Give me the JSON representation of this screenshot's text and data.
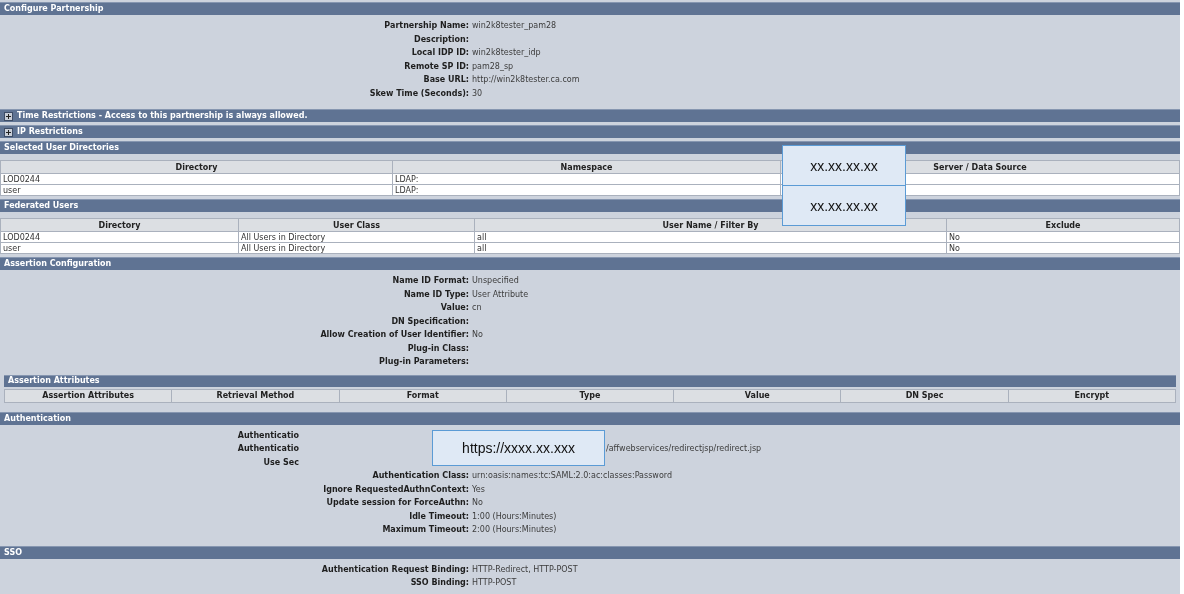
{
  "sections": [
    {
      "kind": "fields",
      "title": "Configure Partnership",
      "fields": [
        {
          "kind": "full",
          "label": "Partnership Name:",
          "value": "win2k8tester_pam28"
        },
        {
          "kind": "full",
          "label": "Description:"
        },
        {
          "kind": "full",
          "label": "Local IDP ID:",
          "value": "win2k8tester_idp"
        },
        {
          "kind": "full",
          "label": "Remote SP ID:",
          "value": "pam28_sp"
        },
        {
          "kind": "full",
          "label": "Base URL:",
          "value": "http://win2k8tester.ca.com"
        },
        {
          "kind": "full",
          "label": "Skew Time (Seconds):",
          "value": "30"
        }
      ]
    },
    {
      "kind": "collapsible",
      "title": "Time Restrictions - Access to this partnership is always allowed.",
      "expanded": false
    },
    {
      "kind": "collapsible",
      "title": "IP Restrictions",
      "expanded": false
    },
    {
      "kind": "table",
      "title": "Selected User Directories",
      "columns": [
        "Directory",
        "Namespace",
        "Server / Data Source"
      ],
      "rows": [
        [
          "LOD0244",
          "LDAP:"
        ],
        [
          "user",
          "LDAP:"
        ]
      ],
      "redactions": [
        "xx.xx.xx.xx",
        "xx.xx.xx.xx"
      ]
    },
    {
      "kind": "table",
      "title": "Federated Users",
      "columns": [
        "Directory",
        "User Class",
        "User Name / Filter By",
        "Exclude"
      ],
      "rows": [
        [
          "LOD0244",
          "All Users in Directory",
          "all",
          "No"
        ],
        [
          "user",
          "All Users in Directory",
          "all",
          "No"
        ]
      ]
    },
    {
      "kind": "fields",
      "title": "Assertion Configuration",
      "fields": [
        {
          "kind": "full",
          "label": "Name ID Format:",
          "value": "Unspecified"
        },
        {
          "kind": "full",
          "label": "Name ID Type:",
          "value": "User Attribute"
        },
        {
          "kind": "full",
          "label": "Value:",
          "value": "cn"
        },
        {
          "kind": "full",
          "label": "DN Specification:"
        },
        {
          "kind": "full",
          "label": "Allow Creation of User Identifier:",
          "value": "No"
        },
        {
          "kind": "full",
          "label": "Plug-in Class:"
        },
        {
          "kind": "full",
          "label": "Plug-in Parameters:"
        }
      ],
      "subtable": {
        "title": "Assertion Attributes",
        "columns": [
          "Assertion Attributes",
          "Retrieval Method",
          "Format",
          "Type",
          "Value",
          "DN Spec",
          "Encrypt"
        ]
      }
    },
    {
      "kind": "fields",
      "title": "Authentication",
      "redactions": [
        "https://xxxx.xx.xxx"
      ],
      "fields": [
        {
          "kind": "masked",
          "label": "Authenticatio"
        },
        {
          "kind": "masked",
          "label": "Authenticatio",
          "value": "/affwebservices/redirectjsp/redirect.jsp"
        },
        {
          "kind": "masked",
          "label": "Use Sec"
        },
        {
          "kind": "full",
          "label": "Authentication Class:",
          "value": "urn:oasis:names:tc:SAML:2.0:ac:classes:Password"
        },
        {
          "kind": "full",
          "label": "Ignore RequestedAuthnContext:",
          "value": "Yes"
        },
        {
          "kind": "full",
          "label": "Update session for ForceAuthn:",
          "value": "No"
        },
        {
          "kind": "full",
          "label": "Idle Timeout:",
          "value": "1:00 (Hours:Minutes)"
        },
        {
          "kind": "full",
          "label": "Maximum Timeout:",
          "value": "2:00 (Hours:Minutes)"
        }
      ]
    },
    {
      "kind": "fields",
      "title": "SSO",
      "fields": [
        {
          "kind": "full",
          "label": "Authentication Request Binding:",
          "value": "HTTP-Redirect, HTTP-POST"
        },
        {
          "kind": "full",
          "label": "SSO Binding:",
          "value": "HTTP-POST"
        }
      ]
    }
  ]
}
